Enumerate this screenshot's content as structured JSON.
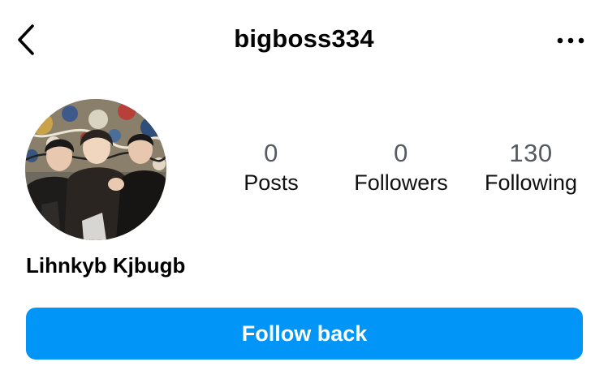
{
  "header": {
    "username": "bigboss334",
    "back_icon": "chevron-left-icon",
    "more_icon": "more-horizontal-icon"
  },
  "profile": {
    "display_name": "Lihnkyb Kjbugb",
    "avatar": "profile-photo"
  },
  "stats": [
    {
      "count": "0",
      "label": "Posts"
    },
    {
      "count": "0",
      "label": "Followers"
    },
    {
      "count": "130",
      "label": "Following"
    }
  ],
  "actions": {
    "follow_label": "Follow back"
  },
  "colors": {
    "accent": "#0095f6",
    "text": "#000000",
    "muted": "#555a60"
  }
}
